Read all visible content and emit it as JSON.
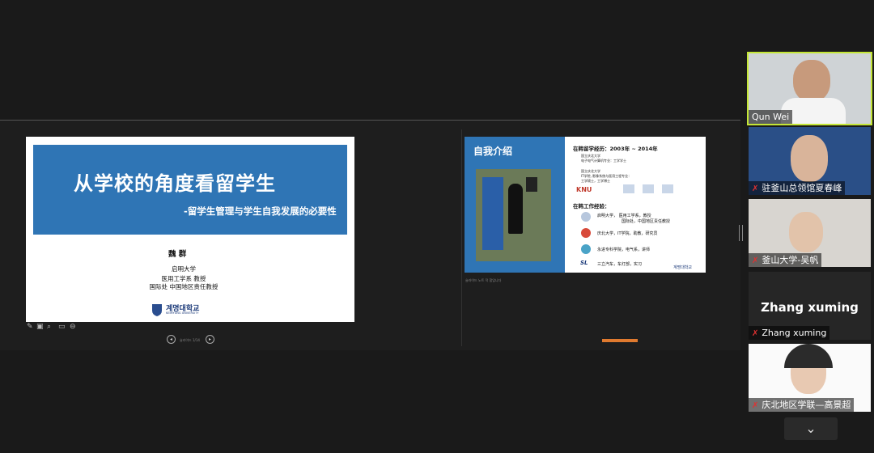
{
  "slide_left": {
    "title": "从学校的角度看留学生",
    "subtitle": "-留学生管理与学生自我发展的必要性",
    "presenter_name": "魏 群",
    "lines": [
      "启明大学",
      "医用工学系 教授",
      "国际处 中国地区责任教授"
    ],
    "logo_text": "계명대학교",
    "logo_sub": "KEIMYUNG UNIVERSITY",
    "page_indicator": "슬라이드 1/14"
  },
  "slide_right": {
    "title": "自我介绍",
    "section1": "在韩留学经历：2003年 ~ 2014年",
    "edu1a": "国立庆北大学",
    "edu1b": "电子电气计算机专业：工学学士",
    "edu2a": "国立庆北大学",
    "edu2b": "IT学院, 影像系统与医用工程专业：",
    "edu2c": "工学硕士，工学博士",
    "knu": "KNU",
    "section2": "在韩工作经验：",
    "jobs": [
      "启明大学，  医用工学系，教授",
      "国际处，中国地区责任教授",
      "庆北大学，IT学院，助教，研究员",
      "永进专科学院，电气系，讲师",
      "三立汽车，车灯部，实习"
    ],
    "sl_logo": "SL",
    "footer_logo": "계명대학교",
    "notes_text": "슬라이드 노트 작 합입니다"
  },
  "participants": [
    {
      "name": "Qun Wei",
      "muted": false
    },
    {
      "name": "驻釜山总领馆夏春峰",
      "muted": true
    },
    {
      "name": "釜山大学-吴帆",
      "muted": true
    },
    {
      "name": "Zhang xuming",
      "muted": true,
      "avatar_text": "Zhang xuming"
    },
    {
      "name": "庆北地区学联—高景超",
      "muted": true
    }
  ],
  "colors": {
    "accent_active": "#c4e636",
    "slide_blue": "#2f75b5",
    "muted_red": "#e03131"
  },
  "icons": {
    "mic_muted": "mic-muted-icon",
    "chevron": "chevron-down-icon"
  }
}
